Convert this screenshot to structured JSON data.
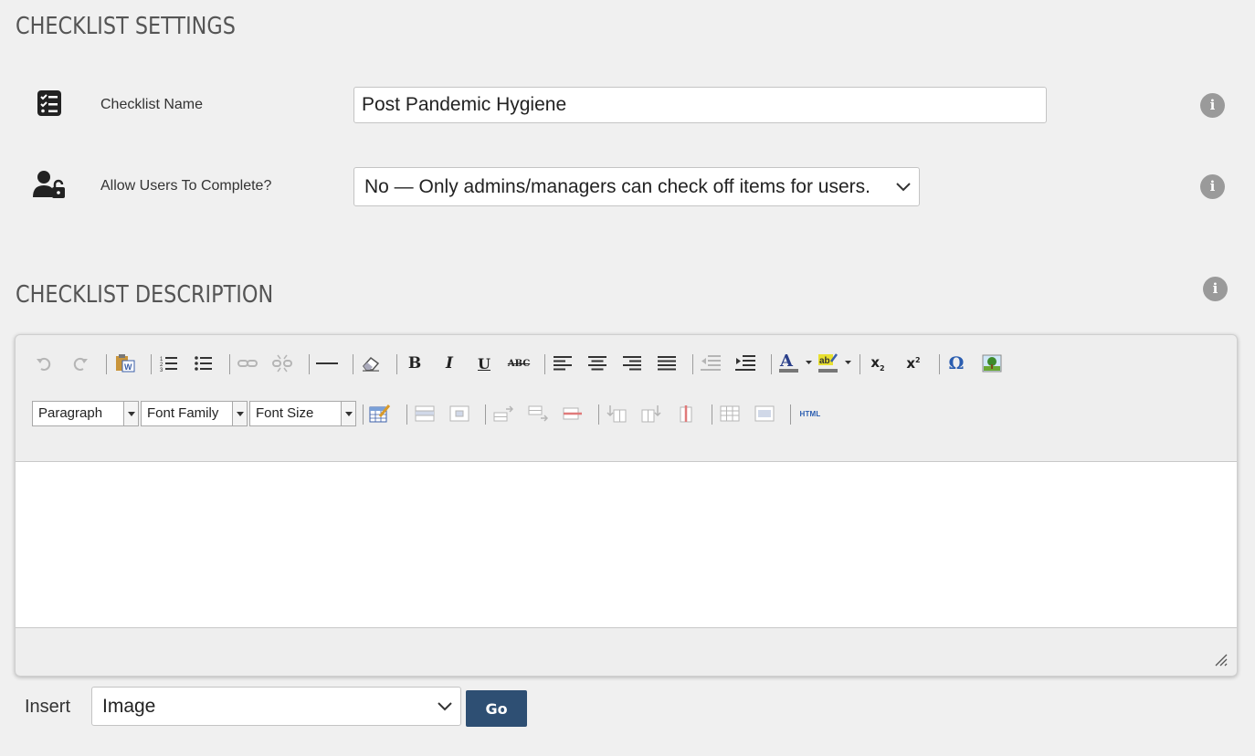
{
  "settings": {
    "title": "CHECKLIST SETTINGS",
    "name_label": "Checklist Name",
    "name_value": "Post Pandemic Hygiene",
    "complete_label": "Allow Users To Complete?",
    "complete_value": "No — Only admins/managers can check off items for users."
  },
  "description": {
    "title": "CHECKLIST DESCRIPTION"
  },
  "editor": {
    "format_select": "Paragraph",
    "font_family_select": "Font Family",
    "font_size_select": "Font Size",
    "html_button": "HTML",
    "colors": {
      "disabled": "#b5b5b5",
      "icon": "#333333",
      "link_blue": "#2a5db0"
    }
  },
  "insert": {
    "label": "Insert",
    "value": "Image",
    "go_label": "Go"
  },
  "colors": {
    "background": "#f0f0f0",
    "title": "#555555",
    "go_button": "#2e4f73",
    "info_icon": "#9a9a9a"
  }
}
